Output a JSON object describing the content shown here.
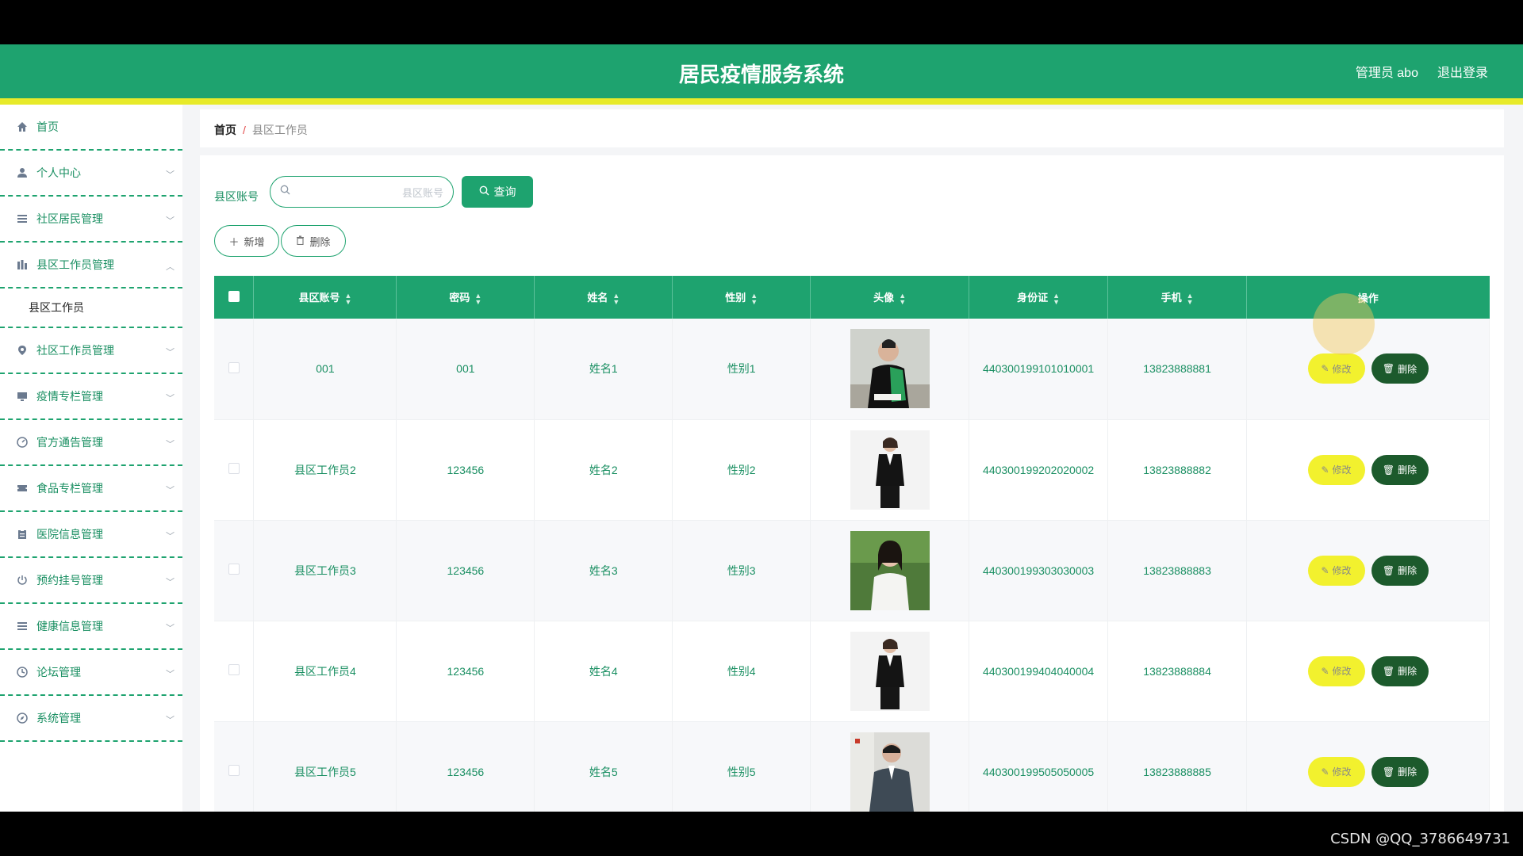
{
  "header": {
    "title": "居民疫情服务系统",
    "user": "管理员 abo",
    "logout": "退出登录"
  },
  "sidebar": {
    "items": [
      {
        "label": "首页",
        "icon": "home-icon",
        "has_chevron": false
      },
      {
        "label": "个人中心",
        "icon": "user-icon",
        "has_chevron": true
      },
      {
        "label": "社区居民管理",
        "icon": "list-icon",
        "has_chevron": true
      },
      {
        "label": "县区工作员管理",
        "icon": "chart-icon",
        "has_chevron": true,
        "expanded": true
      },
      {
        "label": "社区工作员管理",
        "icon": "location-icon",
        "has_chevron": true
      },
      {
        "label": "疫情专栏管理",
        "icon": "monitor-icon",
        "has_chevron": true
      },
      {
        "label": "官方通告管理",
        "icon": "gauge-icon",
        "has_chevron": true
      },
      {
        "label": "食品专栏管理",
        "icon": "ticket-icon",
        "has_chevron": true
      },
      {
        "label": "医院信息管理",
        "icon": "clipboard-icon",
        "has_chevron": true
      },
      {
        "label": "预约挂号管理",
        "icon": "power-icon",
        "has_chevron": true
      },
      {
        "label": "健康信息管理",
        "icon": "list-icon",
        "has_chevron": true
      },
      {
        "label": "论坛管理",
        "icon": "clock-icon",
        "has_chevron": true
      },
      {
        "label": "系统管理",
        "icon": "compass-icon",
        "has_chevron": true
      }
    ],
    "subitem": "县区工作员"
  },
  "breadcrumb": {
    "home": "首页",
    "separator": "/",
    "current": "县区工作员"
  },
  "search": {
    "label": "县区账号",
    "placeholder": "县区账号",
    "value": "",
    "button": "查询"
  },
  "actions": {
    "add": "新增",
    "delete": "删除"
  },
  "table": {
    "columns": [
      "县区账号",
      "密码",
      "姓名",
      "性别",
      "头像",
      "身份证",
      "手机",
      "操作"
    ],
    "edit_label": "修改",
    "delete_label": "删除",
    "rows": [
      {
        "account": "001",
        "password": "001",
        "name": "姓名1",
        "gender": "性别1",
        "id_card": "440300199101010001",
        "phone": "13823888881"
      },
      {
        "account": "县区工作员2",
        "password": "123456",
        "name": "姓名2",
        "gender": "性别2",
        "id_card": "440300199202020002",
        "phone": "13823888882"
      },
      {
        "account": "县区工作员3",
        "password": "123456",
        "name": "姓名3",
        "gender": "性别3",
        "id_card": "440300199303030003",
        "phone": "13823888883"
      },
      {
        "account": "县区工作员4",
        "password": "123456",
        "name": "姓名4",
        "gender": "性别4",
        "id_card": "440300199404040004",
        "phone": "13823888884"
      },
      {
        "account": "县区工作员5",
        "password": "123456",
        "name": "姓名5",
        "gender": "性别5",
        "id_card": "440300199505050005",
        "phone": "13823888885"
      }
    ]
  },
  "watermark": "CSDN @QQ_3786649731",
  "colors": {
    "primary": "#1ea36f",
    "accent_stripe": "#e7ea2a",
    "edit_button": "#f2f12e",
    "delete_button": "#1c5a2c"
  }
}
